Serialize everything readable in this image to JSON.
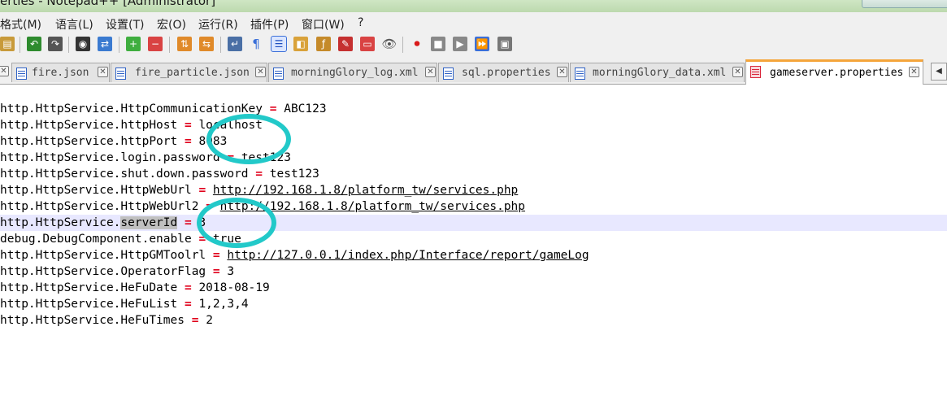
{
  "window": {
    "title": "erties - Notepad++ [Administrator]"
  },
  "menu": [
    "格式(M)",
    "语言(L)",
    "设置(T)",
    "宏(O)",
    "运行(R)",
    "插件(P)",
    "窗口(W)",
    "?"
  ],
  "toolbar": {
    "icons": [
      "paste-icon",
      "undo-icon",
      "redo-icon",
      "find-icon",
      "replace-icon",
      "zoom-in-icon",
      "zoom-out-icon",
      "sync-vertical-icon",
      "sync-horizontal-icon",
      "word-wrap-icon",
      "show-all-chars-icon",
      "indent-guide-icon",
      "doc-map-icon",
      "function-list-icon",
      "folder-workspace-icon",
      "monitoring-icon",
      "record-macro-icon",
      "stop-macro-icon",
      "play-macro-icon",
      "run-macro-multiple-icon",
      "save-macro-icon"
    ]
  },
  "tabs": [
    {
      "label": "fire.json",
      "active": false
    },
    {
      "label": "fire_particle.json",
      "active": false
    },
    {
      "label": "morningGlory_log.xml",
      "active": false
    },
    {
      "label": "sql.properties",
      "active": false
    },
    {
      "label": "morningGlory_data.xml",
      "active": false
    },
    {
      "label": "gameserver.properties",
      "active": true
    }
  ],
  "colors": {
    "operator": "#e0001b",
    "annotation_circle": "#22c9c9",
    "active_tab_accent": "#f5a53b",
    "current_line": "#e8e8ff"
  },
  "editor": {
    "lines": [
      {
        "key": "http.HttpService.HttpCommunicationKey",
        "op": "=",
        "value": "ABC123"
      },
      {
        "key": "http.HttpService.httpHost",
        "op": "=",
        "value": "localhost"
      },
      {
        "key": "http.HttpService.httpPort",
        "op": "=",
        "value": "8083"
      },
      {
        "key": "http.HttpService.login.password",
        "op": "=",
        "value": "test123"
      },
      {
        "key": "http.HttpService.shut.down.password",
        "op": "=",
        "value": "test123"
      },
      {
        "key": "http.HttpService.HttpWebUrl",
        "op": "=",
        "value": "http://192.168.1.8/platform_tw/services.php"
      },
      {
        "key": "http.HttpService.HttpWebUrl2",
        "op": "=",
        "value": "http://192.168.1.8/platform_tw/services.php"
      },
      {
        "key_prefix": "http.HttpService.",
        "key_selected": "serverId",
        "op": "=",
        "value": "3"
      },
      {
        "key": "debug.DebugComponent.enable",
        "op": "=",
        "value": "true"
      },
      {
        "key": "http.HttpService.HttpGMToolrl",
        "op": "=",
        "value": "http://127.0.0.1/index.php/Interface/report/gameLog"
      },
      {
        "key": "http.HttpService.OperatorFlag",
        "op": "=",
        "value": "3"
      },
      {
        "key": "http.HttpService.HeFuDate",
        "op": "=",
        "value": "2018-08-19"
      },
      {
        "key": "http.HttpService.HeFuList",
        "op": "=",
        "value": "1,2,3,4"
      },
      {
        "key": "http.HttpService.HeFuTimes",
        "op": "=",
        "value": "2"
      }
    ]
  }
}
